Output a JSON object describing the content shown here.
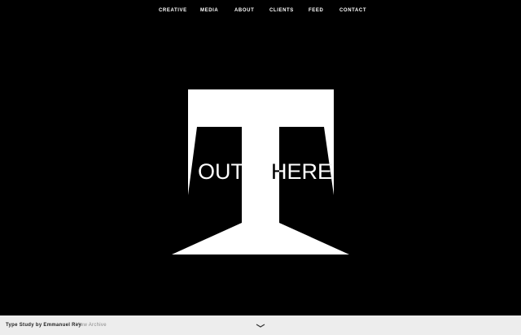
{
  "nav": {
    "items": [
      {
        "label": "CREATIVE"
      },
      {
        "label": "MEDIA"
      },
      {
        "label": "ABOUT"
      },
      {
        "label": "CLIENTS"
      },
      {
        "label": "FEED"
      },
      {
        "label": "CONTACT"
      }
    ]
  },
  "artwork": {
    "letter": "T",
    "overlay_text_left": "OUT",
    "overlay_text_right": "HERE"
  },
  "footer": {
    "credit": "Type Study by Emmanuel Rey",
    "archive_link": "View Archive",
    "chevron_icon": "chevron-down-icon"
  },
  "colors": {
    "background": "#000000",
    "foreground": "#ffffff",
    "footer_background": "#ededed"
  }
}
